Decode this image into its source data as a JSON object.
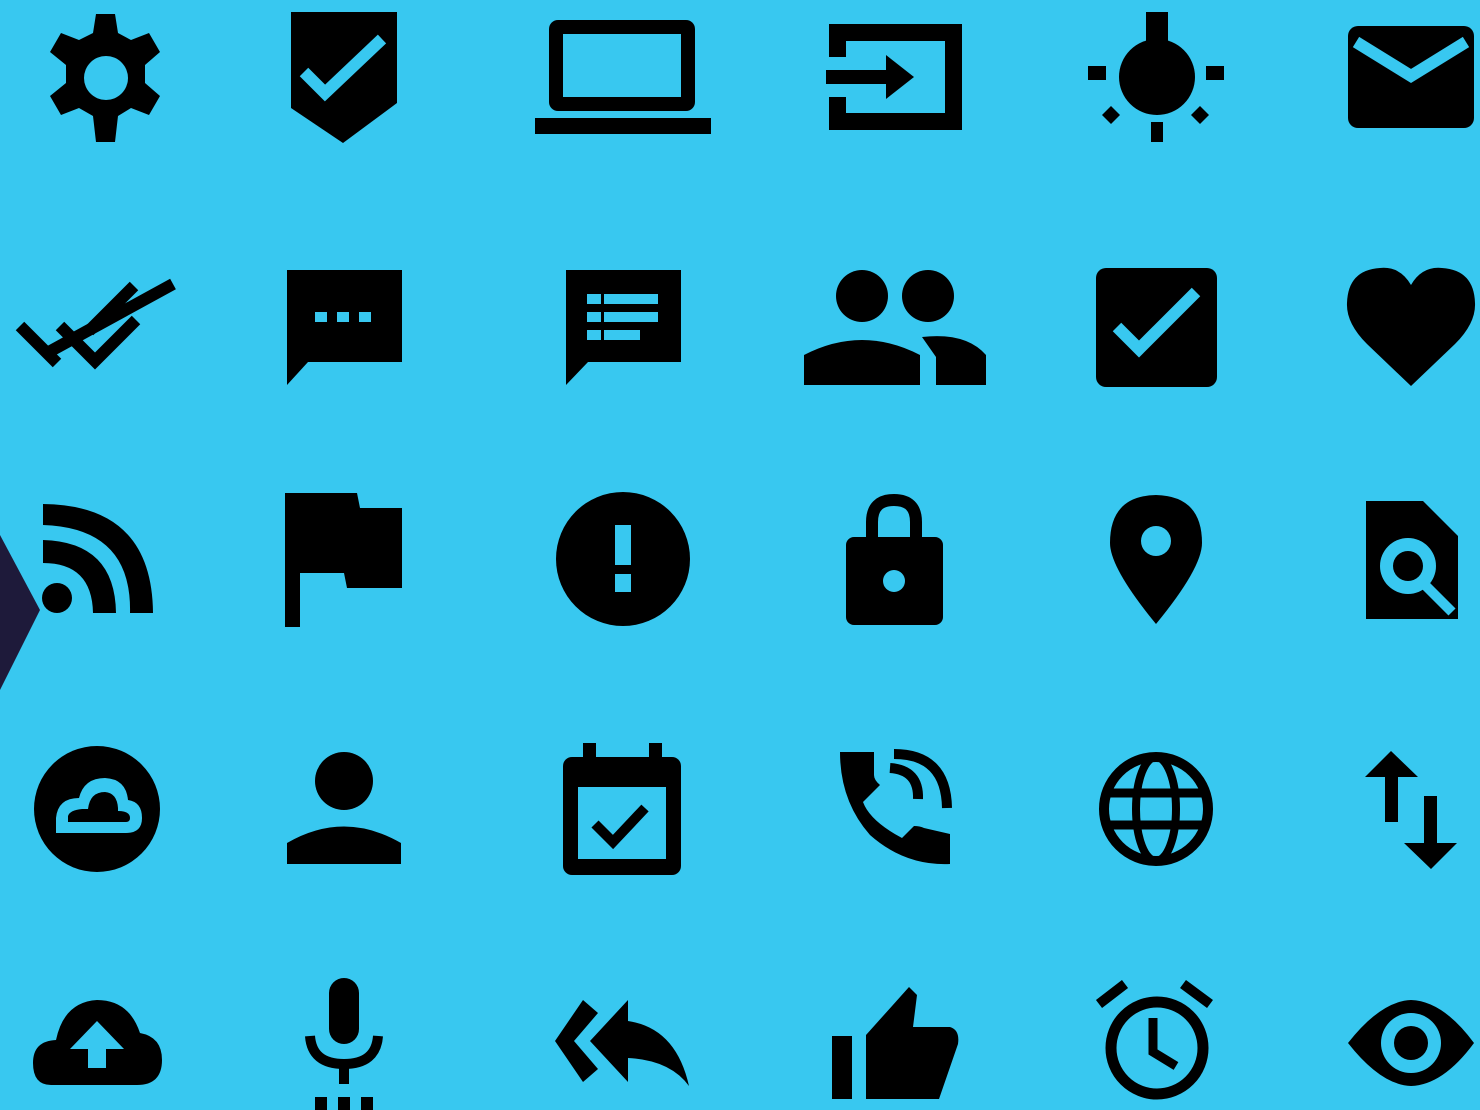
{
  "background_color": "#38C8F0",
  "icon_color": "#000000",
  "edge_shape_color": "#1E1A3A",
  "icon_grid": [
    [
      "gear-icon",
      "shield-check-icon",
      "laptop-icon",
      "input-arrow-icon",
      "lightbulb-icon",
      "mail-icon"
    ],
    [
      "double-check-icon",
      "chat-bubble-ellipsis-icon",
      "chat-bubble-list-icon",
      "group-people-icon",
      "checkbox-checked-icon",
      "heart-icon"
    ],
    [
      "rss-feed-icon",
      "flag-icon",
      "alert-circle-icon",
      "lock-icon",
      "location-pin-icon",
      "document-search-icon"
    ],
    [
      "cloud-circle-icon",
      "person-icon",
      "calendar-check-icon",
      "phone-callback-icon",
      "globe-icon",
      "swap-vertical-icon"
    ],
    [
      "cloud-upload-icon",
      "microphone-icon",
      "reply-all-icon",
      "thumbs-up-icon",
      "alarm-clock-icon",
      "eye-icon"
    ]
  ]
}
